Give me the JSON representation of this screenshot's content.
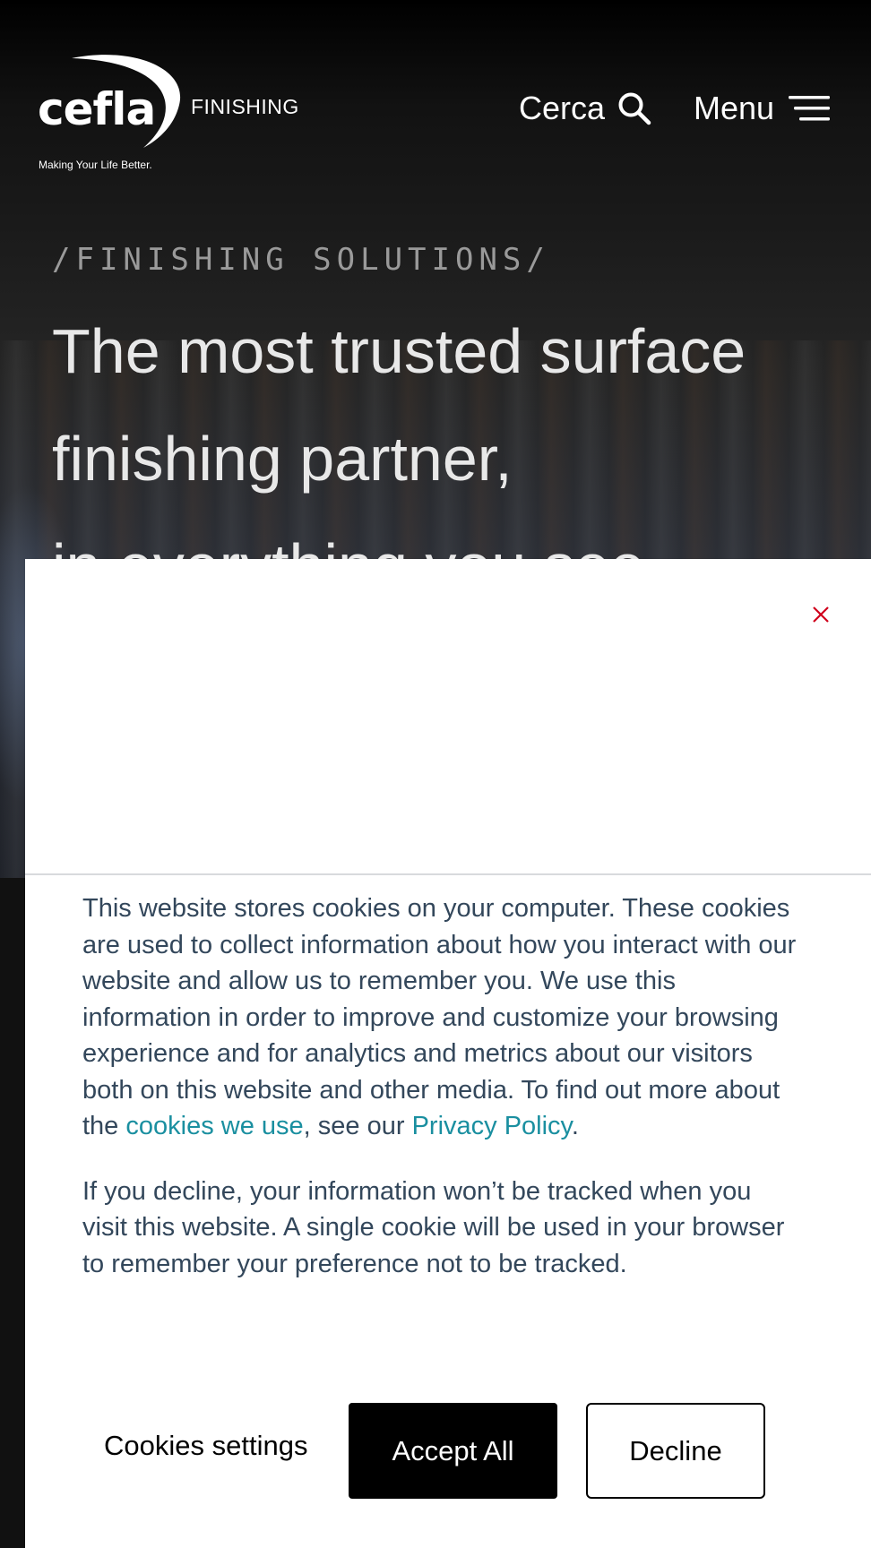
{
  "header": {
    "logo_text": "cefla",
    "logo_tagline": "Making Your Life Better.",
    "brand_division": "FINISHING",
    "search_label": "Cerca",
    "menu_label": "Menu"
  },
  "hero": {
    "eyebrow": "/FINISHING SOLUTIONS/",
    "headline_line1": "The most trusted surface",
    "headline_line2": "finishing partner,",
    "headline_line3": "in everything you see."
  },
  "cookie_banner": {
    "close_icon": "close-icon",
    "paragraph1_text": "This website stores cookies on your computer. These cookies are used to collect information about how you interact with our website and allow us to remember you. We use this information in order to improve and customize your browsing experience and for analytics and metrics about our visitors both on this website and other media. To find out more about the ",
    "cookies_link": "cookies we use",
    "paragraph1_mid": ", see our ",
    "privacy_link": "Privacy Policy",
    "paragraph1_end": ".",
    "paragraph2": "If you decline, your information won’t be tracked when you visit this website. A single cookie will be used in your browser to remember your preference not to be tracked.",
    "settings_label": "Cookies settings",
    "accept_label": "Accept All",
    "decline_label": "Decline"
  },
  "colors": {
    "accent_link": "#1a8fa0",
    "close_icon": "#d0021b",
    "body_text": "#33475b"
  }
}
